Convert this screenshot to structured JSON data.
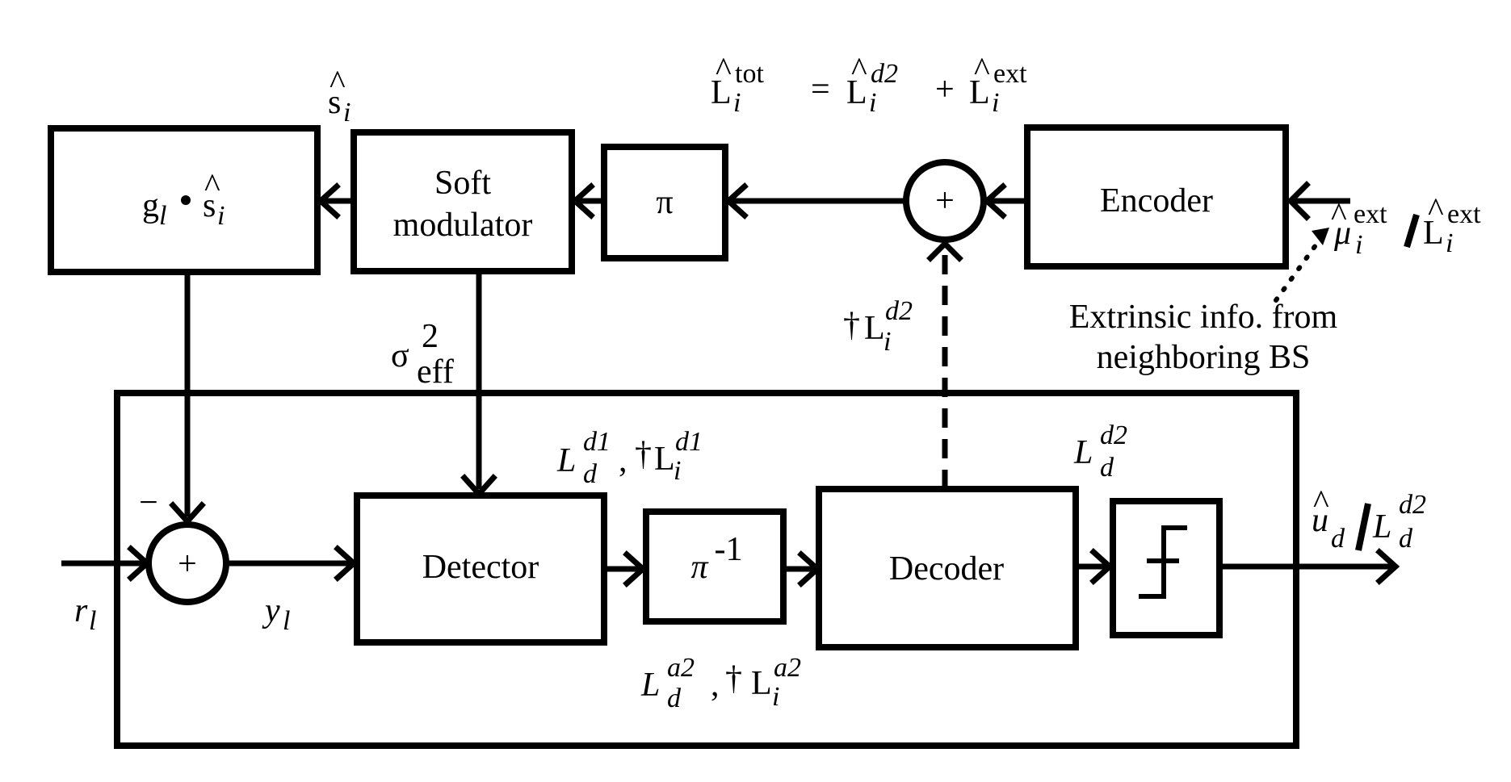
{
  "diagram": {
    "title_equation": {
      "lhs": "L",
      "lhs_sup": "tot",
      "lhs_sub": "i",
      "equals": "=",
      "term1": "L",
      "term1_sup": "d2",
      "term1_sub": "i",
      "plus": "+",
      "term2": "L",
      "term2_sup": "ext",
      "term2_sub": "i",
      "hat": "^"
    },
    "blocks": {
      "gain": {
        "g": "g",
        "g_sub": "l",
        "dot": "•",
        "s": "s",
        "s_sub": "i",
        "hat": "^"
      },
      "soft_modulator": {
        "line1": "Soft",
        "line2": "modulator"
      },
      "interleaver": {
        "label": "π"
      },
      "adder_top": {
        "label": "+"
      },
      "encoder": {
        "label": "Encoder"
      },
      "adder_bottom": {
        "label": "+",
        "minus": "−"
      },
      "detector": {
        "label": "Detector"
      },
      "deinterleaver": {
        "label": "π",
        "sup": "-1"
      },
      "decoder": {
        "label": "Decoder"
      },
      "hard_decision": {
        "label": "hard-decision"
      }
    },
    "labels": {
      "s_hat": {
        "s": "s",
        "sub": "i",
        "hat": "^"
      },
      "sigma_eff": {
        "sigma": "σ",
        "sup": "2",
        "sub": "eff"
      },
      "dagger_L_d2": {
        "dagger": "†",
        "L": "L",
        "sup": "d2",
        "sub": "i"
      },
      "L_d1": {
        "L1": "L",
        "sup1": "d1",
        "sub1": "d",
        "comma": ",",
        "dagger": "†",
        "L2": "L",
        "sup2": "d1",
        "sub2": "i"
      },
      "L_a2": {
        "L1": "L",
        "sup1": "a2",
        "sub1": "d",
        "comma": ",",
        "dagger": "†",
        "L2": "L",
        "sup2": "a2",
        "sub2": "i"
      },
      "L_d2_out": {
        "L": "L",
        "sup": "d2",
        "sub": "d"
      },
      "r_l": {
        "r": "r",
        "sub": "l"
      },
      "y_l": {
        "y": "y",
        "sub": "l"
      },
      "output": {
        "u": "u",
        "u_sub": "d",
        "hat": "^",
        "slash": "/",
        "L": "L",
        "sup": "d2",
        "sub": "d"
      },
      "ext_input": {
        "mu": "μ",
        "mu_sup": "ext",
        "mu_sub": "i",
        "slash": "/",
        "L": "L",
        "sup": "ext",
        "sub": "i",
        "hat": "^"
      },
      "extrinsic_note": {
        "line1": "Extrinsic info. from",
        "line2": "neighboring BS"
      }
    }
  }
}
